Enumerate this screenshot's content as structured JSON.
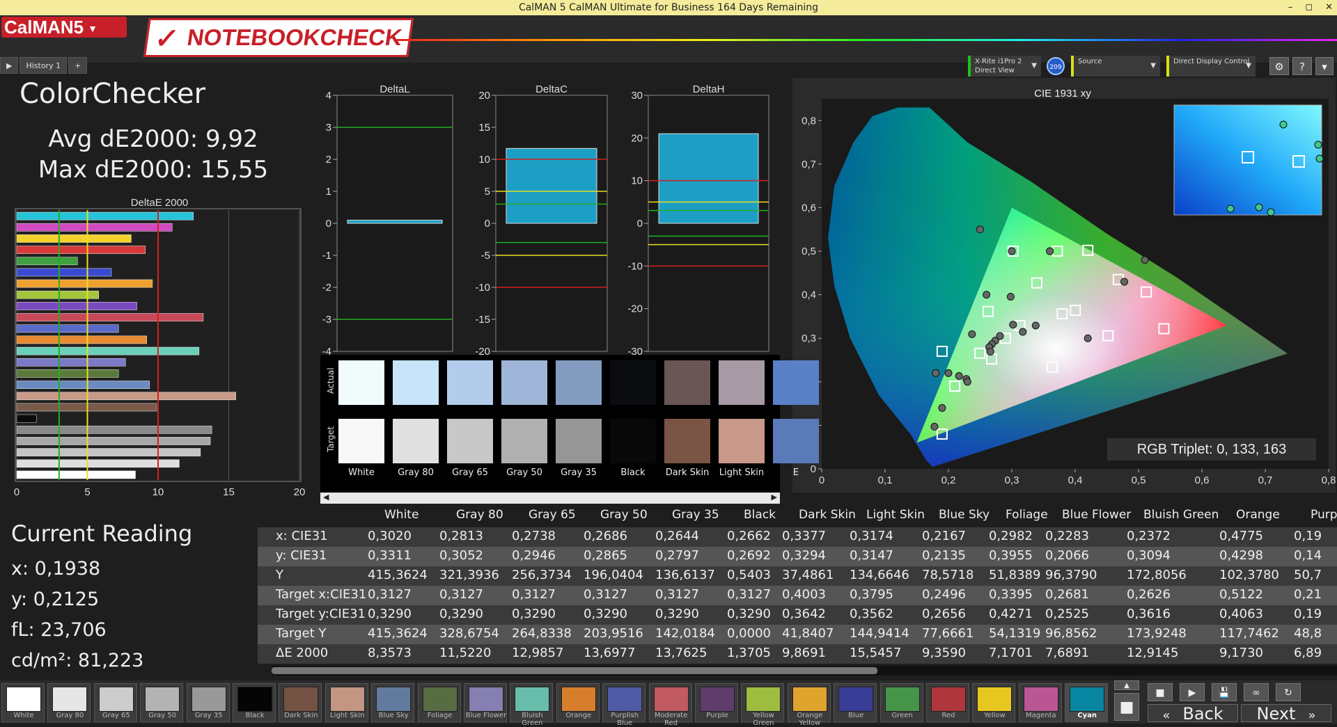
{
  "window": {
    "title": "CalMAN 5 CalMAN Ultimate for Business 164 Days Remaining",
    "min": "–",
    "max": "◻",
    "close": "✕"
  },
  "app": {
    "logo": "CalMAN5",
    "watermark": "NOTEBOOKCHECK"
  },
  "history": {
    "tab": "History 1",
    "add": "+"
  },
  "devices": {
    "meter": {
      "line1": "X-Rite i1Pro 2",
      "line2": "Direct View"
    },
    "meter_badge": "209",
    "source": "Source",
    "display": "Direct Display Control"
  },
  "toolbar": {
    "gear": "⚙",
    "help": "?",
    "scroll": "▾"
  },
  "summary": {
    "title": "ColorChecker",
    "avg": "Avg dE2000: 9,92",
    "max": "Max dE2000: 15,55"
  },
  "colors": {
    "green_line": "#22b022",
    "yellow_line": "#e8e020",
    "red_line": "#d42020",
    "bar_fill": "#1d9ec4"
  },
  "chart_data": [
    {
      "type": "bar",
      "title": "DeltaE 2000",
      "orientation": "horizontal",
      "xlim": [
        0,
        20
      ],
      "xticks": [
        "0",
        "5",
        "10",
        "15",
        "20"
      ],
      "categories": [
        "Cyan",
        "Magenta",
        "Yellow",
        "Red",
        "Green",
        "Blue",
        "Orange Yellow",
        "Yellow Green",
        "Purple",
        "Moderate Red",
        "Purplish Blue",
        "Orange",
        "Bluish Green",
        "Blue Flower",
        "Foliage",
        "Blue Sky",
        "Light Skin",
        "Dark Skin",
        "Black",
        "Gray 35",
        "Gray 50",
        "Gray 65",
        "Gray 80",
        "White"
      ],
      "values": [
        12.5,
        11.0,
        8.1,
        9.1,
        4.3,
        6.7,
        9.6,
        5.8,
        8.5,
        13.2,
        7.2,
        9.2,
        12.9,
        7.7,
        7.2,
        9.4,
        15.5,
        9.9,
        1.4,
        13.8,
        13.7,
        13.0,
        11.5,
        8.4
      ],
      "bar_colors": [
        "#26c4d8",
        "#d04ac0",
        "#f4d22c",
        "#d83a3a",
        "#3ea040",
        "#3a4ad0",
        "#f0a030",
        "#a4c63a",
        "#7a4ac0",
        "#c84a5a",
        "#5a6ac8",
        "#e88a30",
        "#6ad0b8",
        "#7a7ac8",
        "#5a7a3a",
        "#6a8ac0",
        "#c89a88",
        "#7a5a4a",
        "#0a0a0a",
        "#8a8a8a",
        "#a8a8a8",
        "#c4c4c4",
        "#dedede",
        "#ffffff"
      ],
      "thresholds": [
        3,
        5,
        10
      ]
    },
    {
      "type": "bar",
      "title": "DeltaL",
      "ylim": [
        -4,
        4
      ],
      "yticks": [
        "4",
        "3",
        "2",
        "1",
        "0",
        "-1",
        "-2",
        "-3",
        "-4"
      ],
      "values": [
        0.1
      ],
      "lines": [
        {
          "value": 3,
          "color": "green"
        },
        {
          "value": -3,
          "color": "green"
        }
      ]
    },
    {
      "type": "bar",
      "title": "DeltaC",
      "ylim": [
        -20,
        20
      ],
      "yticks": [
        "20",
        "15",
        "10",
        "5",
        "0",
        "-5",
        "-10",
        "-15",
        "-20"
      ],
      "values": [
        11.7
      ],
      "lines": [
        {
          "value": 10,
          "color": "red"
        },
        {
          "value": 5,
          "color": "yellow"
        },
        {
          "value": 3,
          "color": "green"
        },
        {
          "value": -3,
          "color": "green"
        },
        {
          "value": -5,
          "color": "yellow"
        },
        {
          "value": -10,
          "color": "red"
        }
      ]
    },
    {
      "type": "bar",
      "title": "DeltaH",
      "ylim": [
        -30,
        30
      ],
      "yticks": [
        "30",
        "20",
        "10",
        "0",
        "-10",
        "-20",
        "-30"
      ],
      "values": [
        21
      ],
      "lines": [
        {
          "value": 10,
          "color": "red"
        },
        {
          "value": 5,
          "color": "yellow"
        },
        {
          "value": 3,
          "color": "green"
        },
        {
          "value": -3,
          "color": "green"
        },
        {
          "value": -5,
          "color": "yellow"
        },
        {
          "value": -10,
          "color": "red"
        }
      ]
    },
    {
      "type": "scatter",
      "title": "CIE 1931 xy",
      "xlim": [
        0,
        0.8
      ],
      "ylim": [
        0,
        0.85
      ],
      "xticks": [
        "0",
        "0,1",
        "0,2",
        "0,3",
        "0,4",
        "0,5",
        "0,6",
        "0,7",
        "0,8"
      ],
      "yticks": [
        "0",
        "0,1",
        "0,2",
        "0,3",
        "0,4",
        "0,5",
        "0,6",
        "0,7",
        "0,8"
      ],
      "gamut_target": [
        [
          0.64,
          0.33
        ],
        [
          0.3,
          0.6
        ],
        [
          0.15,
          0.06
        ]
      ],
      "targets": [
        [
          0.3127,
          0.329
        ],
        [
          0.4003,
          0.3642
        ],
        [
          0.3795,
          0.3562
        ],
        [
          0.2496,
          0.2656
        ],
        [
          0.3395,
          0.4271
        ],
        [
          0.2681,
          0.2525
        ],
        [
          0.2626,
          0.3616
        ],
        [
          0.5122,
          0.4063
        ],
        [
          0.21,
          0.19
        ],
        [
          0.4518,
          0.3058
        ],
        [
          0.372,
          0.5
        ],
        [
          0.468,
          0.435
        ],
        [
          0.19,
          0.08
        ],
        [
          0.302,
          0.5
        ],
        [
          0.54,
          0.322
        ],
        [
          0.42,
          0.502
        ],
        [
          0.364,
          0.234
        ],
        [
          0.19,
          0.27
        ],
        [
          0.29,
          0.3
        ]
      ],
      "measured": [
        [
          0.302,
          0.3311
        ],
        [
          0.2813,
          0.3052
        ],
        [
          0.2738,
          0.2946
        ],
        [
          0.2686,
          0.2865
        ],
        [
          0.2644,
          0.2797
        ],
        [
          0.2662,
          0.2692
        ],
        [
          0.3377,
          0.3294
        ],
        [
          0.3174,
          0.3147
        ],
        [
          0.2167,
          0.2135
        ],
        [
          0.2982,
          0.3955
        ],
        [
          0.2283,
          0.2066
        ],
        [
          0.2372,
          0.3094
        ],
        [
          0.4775,
          0.4298
        ],
        [
          0.19,
          0.14
        ],
        [
          0.42,
          0.3
        ],
        [
          0.26,
          0.4
        ],
        [
          0.178,
          0.097
        ],
        [
          0.25,
          0.55
        ],
        [
          0.3,
          0.5
        ],
        [
          0.51,
          0.48
        ],
        [
          0.36,
          0.5
        ],
        [
          0.2,
          0.22
        ],
        [
          0.23,
          0.2
        ],
        [
          0.18,
          0.22
        ]
      ],
      "readout": "RGB Triplet: 0, 133, 163"
    }
  ],
  "swatch_panel": {
    "actual_label": "Actual",
    "target_label": "Target",
    "items": [
      {
        "name": "White",
        "actual": "#f0fcfc",
        "target": "#f8f8f8"
      },
      {
        "name": "Gray 80",
        "actual": "#c8e4fa",
        "target": "#e0e0e0"
      },
      {
        "name": "Gray 65",
        "actual": "#b4ccec",
        "target": "#c8c8c8"
      },
      {
        "name": "Gray 50",
        "actual": "#a0b6d8",
        "target": "#b0b0b0"
      },
      {
        "name": "Gray 35",
        "actual": "#849cc0",
        "target": "#969696"
      },
      {
        "name": "Black",
        "actual": "#0a0c10",
        "target": "#080808"
      },
      {
        "name": "Dark Skin",
        "actual": "#6a5656",
        "target": "#7a5444"
      },
      {
        "name": "Light Skin",
        "actual": "#a89aa4",
        "target": "#c89888"
      },
      {
        "name": "E",
        "actual": "#5a80c8",
        "target": "#5a7ab8"
      }
    ]
  },
  "table": {
    "columns": [
      "White",
      "Gray 80",
      "Gray 65",
      "Gray 50",
      "Gray 35",
      "Black",
      "Dark Skin",
      "Light Skin",
      "Blue Sky",
      "Foliage",
      "Blue Flower",
      "Bluish Green",
      "Orange",
      "Purp"
    ],
    "rows": [
      {
        "label": "x: CIE31",
        "values": [
          "0,3020",
          "0,2813",
          "0,2738",
          "0,2686",
          "0,2644",
          "0,2662",
          "0,3377",
          "0,3174",
          "0,2167",
          "0,2982",
          "0,2283",
          "0,2372",
          "0,4775",
          "0,19"
        ]
      },
      {
        "label": "y: CIE31",
        "values": [
          "0,3311",
          "0,3052",
          "0,2946",
          "0,2865",
          "0,2797",
          "0,2692",
          "0,3294",
          "0,3147",
          "0,2135",
          "0,3955",
          "0,2066",
          "0,3094",
          "0,4298",
          "0,14"
        ]
      },
      {
        "label": "Y",
        "values": [
          "415,3624",
          "321,3936",
          "256,3734",
          "196,0404",
          "136,6137",
          "0,5403",
          "37,4861",
          "134,6646",
          "78,5718",
          "51,8389",
          "96,3790",
          "172,8056",
          "102,3780",
          "50,7"
        ]
      },
      {
        "label": "Target x:CIE31",
        "values": [
          "0,3127",
          "0,3127",
          "0,3127",
          "0,3127",
          "0,3127",
          "0,3127",
          "0,4003",
          "0,3795",
          "0,2496",
          "0,3395",
          "0,2681",
          "0,2626",
          "0,5122",
          "0,21"
        ]
      },
      {
        "label": "Target y:CIE31",
        "values": [
          "0,3290",
          "0,3290",
          "0,3290",
          "0,3290",
          "0,3290",
          "0,3290",
          "0,3642",
          "0,3562",
          "0,2656",
          "0,4271",
          "0,2525",
          "0,3616",
          "0,4063",
          "0,19"
        ]
      },
      {
        "label": "Target Y",
        "values": [
          "415,3624",
          "328,6754",
          "264,8338",
          "203,9516",
          "142,0184",
          "0,0000",
          "41,8407",
          "144,9414",
          "77,6661",
          "54,1319",
          "96,8562",
          "173,9248",
          "117,7462",
          "48,8"
        ]
      },
      {
        "label": "ΔE 2000",
        "values": [
          "8,3573",
          "11,5220",
          "12,9857",
          "13,6977",
          "13,7625",
          "1,3705",
          "9,8691",
          "15,5457",
          "9,3590",
          "7,1701",
          "7,6891",
          "12,9145",
          "9,1730",
          "6,89"
        ]
      }
    ]
  },
  "current_reading": {
    "title": "Current Reading",
    "x": "x: 0,1938",
    "y": "y: 0,2125",
    "fl": "fL: 23,706",
    "cdm2": "cd/m²: 81,223"
  },
  "patches": [
    {
      "label": "White",
      "color": "#ffffff"
    },
    {
      "label": "Gray 80",
      "color": "#e6e6e6"
    },
    {
      "label": "Gray 65",
      "color": "#cccccc"
    },
    {
      "label": "Gray 50",
      "color": "#b3b3b3"
    },
    {
      "label": "Gray 35",
      "color": "#999999"
    },
    {
      "label": "Black",
      "color": "#050505"
    },
    {
      "label": "Dark Skin",
      "color": "#735244"
    },
    {
      "label": "Light Skin",
      "color": "#c29682"
    },
    {
      "label": "Blue Sky",
      "color": "#627a9d"
    },
    {
      "label": "Foliage",
      "color": "#576c43"
    },
    {
      "label": "Blue Flower",
      "color": "#8580b1"
    },
    {
      "label": "Bluish Green",
      "color": "#67bdaa"
    },
    {
      "label": "Orange",
      "color": "#d67e2c"
    },
    {
      "label": "Purplish Blue",
      "color": "#505ba6"
    },
    {
      "label": "Moderate Red",
      "color": "#c15a63"
    },
    {
      "label": "Purple",
      "color": "#5e3c6c"
    },
    {
      "label": "Yellow Green",
      "color": "#9dbc40"
    },
    {
      "label": "Orange Yellow",
      "color": "#e0a32e"
    },
    {
      "label": "Blue",
      "color": "#383d96"
    },
    {
      "label": "Green",
      "color": "#469449"
    },
    {
      "label": "Red",
      "color": "#af363c"
    },
    {
      "label": "Yellow",
      "color": "#e7c71f"
    },
    {
      "label": "Magenta",
      "color": "#bb5695"
    },
    {
      "label": "Cyan",
      "color": "#0885a1"
    }
  ],
  "selected_patch": "Cyan",
  "controls": {
    "stop": "■",
    "play": "▶",
    "save": "💾",
    "loop": "∞",
    "refresh": "↻"
  },
  "nav": {
    "back": "Back",
    "next": "Next",
    "back_icon": "«",
    "next_icon": "»"
  }
}
